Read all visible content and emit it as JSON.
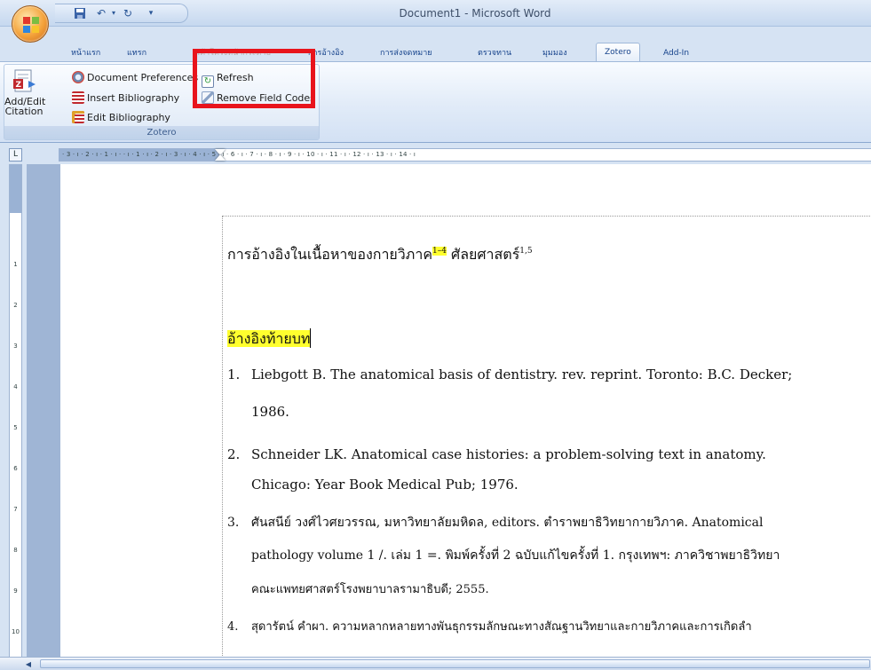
{
  "window": {
    "title": "Document1 - Microsoft Word"
  },
  "quick_access": {
    "save_icon": "save-icon",
    "undo_icon": "undo-icon",
    "redo_icon": "redo-icon",
    "customize_icon": "customize-icon"
  },
  "tabs": [
    {
      "label": "หน้าแรก"
    },
    {
      "label": "แทรก"
    },
    {
      "label": "เค้าโครงหน้ากระดาษ"
    },
    {
      "label": "การอ้างอิง"
    },
    {
      "label": "การส่งจดหมาย"
    },
    {
      "label": "ตรวจทาน"
    },
    {
      "label": "มุมมอง"
    },
    {
      "label": "Zotero"
    },
    {
      "label": "Add-In"
    }
  ],
  "ribbon": {
    "group_label": "Zotero",
    "add_edit_citation": "Add/Edit Citation",
    "add_edit_line1": "Add/Edit",
    "add_edit_line2": "Citation",
    "document_preferences": "Document Preferences",
    "insert_bibliography": "Insert Bibliography",
    "edit_bibliography": "Edit Bibliography",
    "refresh": "Refresh",
    "remove_field_codes": "Remove Field Codes"
  },
  "document": {
    "heading_pre": "การอ้างอิงในเนื้อหาของกายวิภาค",
    "heading_cite1": "1–4",
    "heading_mid": " ศัลยศาสตร์",
    "heading_cite2": "1,5",
    "bib_heading": "อ้างอิงท้ายบท",
    "refs": [
      {
        "num": "1.",
        "line1": "Liebgott B. The anatomical basis of dentistry. rev. reprint. Toronto: B.C. Decker;",
        "line2": "1986."
      },
      {
        "num": "2.",
        "line1": "Schneider LK. Anatomical case histories: a problem-solving text in anatomy.",
        "line2": "Chicago: Year Book Medical Pub; 1976."
      },
      {
        "num": "3.",
        "line1": "ศันสนีย์ วงศ์ไวศยวรรณ, มหาวิทยาลัยมหิดล, editors. ตำราพยาธิวิทยากายวิภาค. Anatomical",
        "line2": "pathology volume 1 /. เล่ม 1 =. พิมพ์ครั้งที่ 2 ฉบับแก้ไขครั้งที่ 1. กรุงเทพฯ: ภาควิชาพยาธิวิทยา",
        "line3": "คณะแพทยศาสตร์โรงพยาบาลรามาธิบดี; 2555."
      },
      {
        "num": "4.",
        "line1": "สุดารัตน์ คำผา. ความหลากหลายทางพันธุกรรมลักษณะทางสัณฐานวิทยาและกายวิภาคและการเกิดลำ"
      }
    ]
  },
  "ruler": {
    "h_ticks": "· 3 · ı · 2 · ı · 1 · ı ·  · ı · 1 · ı · 2 · ı · 3 · ı · 4 · ı · 5 · ı · 6 · ı · 7 · ı · 8 · ı · 9 · ı · 10 · ı · 11 · ı · 12 · ı · 13 · ı · 14 · ı"
  }
}
